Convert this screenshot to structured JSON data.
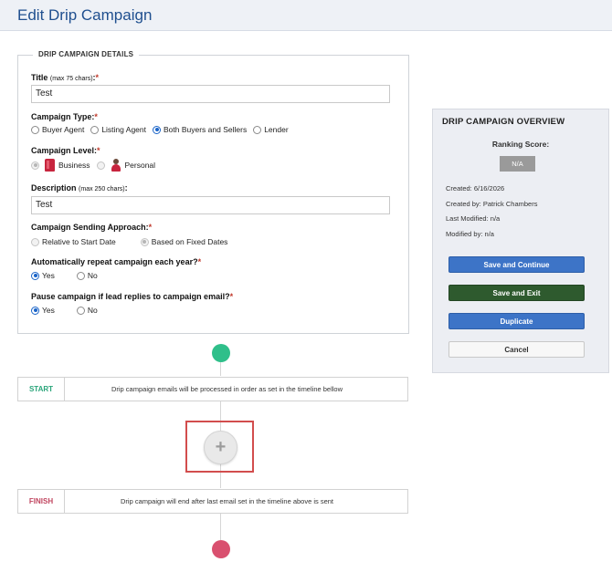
{
  "header": {
    "title": "Edit Drip Campaign"
  },
  "details": {
    "legend": "DRIP CAMPAIGN DETAILS",
    "title_field": {
      "label": "Title",
      "hint": "(max 75 chars)",
      "suffix": ":",
      "required": "*",
      "value": "Test"
    },
    "campaign_type": {
      "label": "Campaign Type:",
      "required": "*",
      "options": [
        "Buyer Agent",
        "Listing Agent",
        "Both Buyers and Sellers",
        "Lender"
      ],
      "selected": "Both Buyers and Sellers"
    },
    "campaign_level": {
      "label": "Campaign Level:",
      "required": "*",
      "options": [
        "Business",
        "Personal"
      ],
      "selected": "Business"
    },
    "description_field": {
      "label": "Description",
      "hint": "(max 250 chars)",
      "suffix": ":",
      "value": "Test"
    },
    "sending_approach": {
      "label": "Campaign Sending Approach:",
      "required": "*",
      "options": [
        "Relative to Start Date",
        "Based on Fixed Dates"
      ],
      "selected": "Based on Fixed Dates"
    },
    "repeat_yearly": {
      "label": "Automatically repeat campaign each year?",
      "required": "*",
      "options": [
        "Yes",
        "No"
      ],
      "selected": "Yes"
    },
    "pause_on_reply": {
      "label": "Pause campaign if lead replies to campaign email?",
      "required": "*",
      "options": [
        "Yes",
        "No"
      ],
      "selected": "Yes"
    }
  },
  "timeline": {
    "start": {
      "tag": "START",
      "message": "Drip campaign emails will be processed in order as set in the timeline bellow"
    },
    "add_button": "+",
    "finish": {
      "tag": "FINISH",
      "message": "Drip campaign will end after last email set in the timeline above is sent"
    }
  },
  "overview": {
    "title": "DRIP CAMPAIGN OVERVIEW",
    "ranking_label": "Ranking Score:",
    "ranking_value": "N/A",
    "created": "Created: 6/16/2026",
    "created_by": "Created by: Patrick Chambers",
    "last_modified": "Last Modified: n/a",
    "modified_by": "Modified by: n/a",
    "buttons": {
      "save_continue": "Save and Continue",
      "save_exit": "Save and Exit",
      "duplicate": "Duplicate",
      "cancel": "Cancel"
    }
  },
  "colors": {
    "header_text": "#1f4f8f",
    "start_dot": "#2fbf8a",
    "finish_dot": "#d9506f",
    "highlight_frame": "#d24d4d",
    "button_blue": "#3d74c7",
    "button_green": "#2e5a2e"
  }
}
